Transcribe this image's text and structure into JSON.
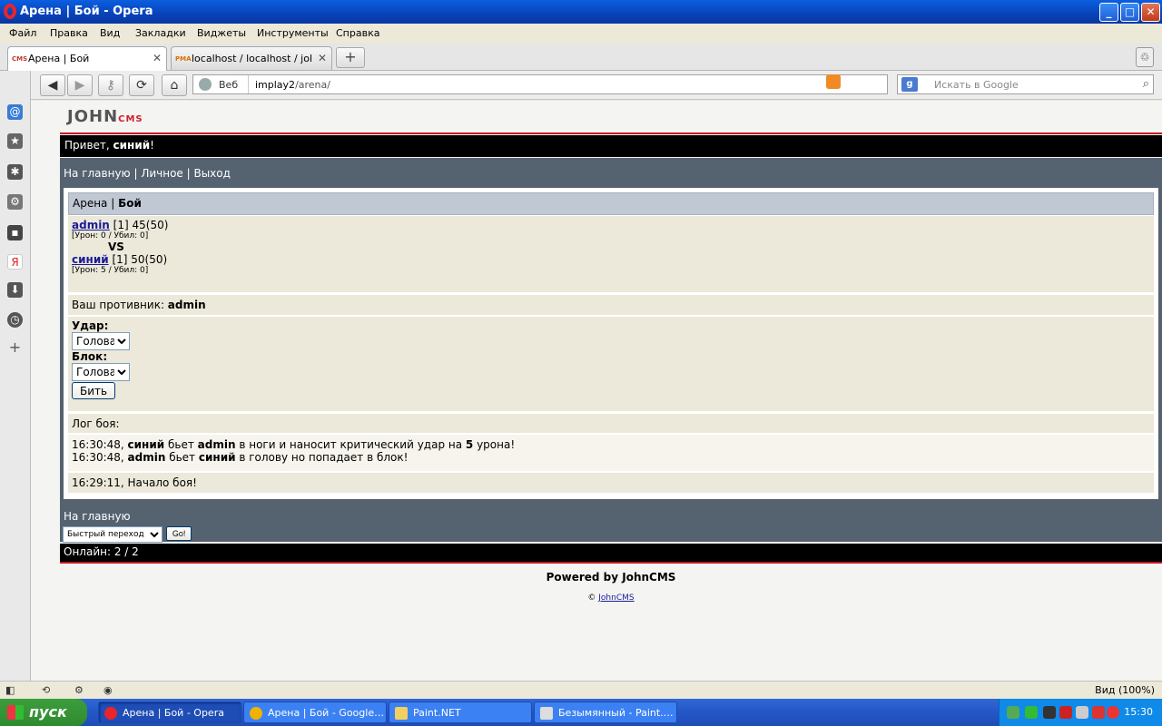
{
  "window": {
    "title": "Арена | Бой - Opera",
    "min_label": "_",
    "max_label": "□",
    "close_label": "✕"
  },
  "menu": [
    "Файл",
    "Правка",
    "Вид",
    "Закладки",
    "Виджеты",
    "Инструменты",
    "Справка"
  ],
  "tabs": [
    {
      "label": "Арена | Бой",
      "close": "✕"
    },
    {
      "label": "localhost / localhost / joh…",
      "close": "✕"
    }
  ],
  "addressbar": {
    "web_label": "Веб",
    "url_host": "implay2",
    "url_path": "/arena/",
    "search_placeholder": "Искать в Google"
  },
  "page": {
    "logo_main": "JOHN",
    "logo_sub": "CMS",
    "greeting_prefix": "Привет, ",
    "greeting_user": "синий",
    "greeting_suffix": "!",
    "nav": {
      "home": "На главную",
      "sep1": " | ",
      "personal": "Личное",
      "sep2": " | ",
      "logout": "Выход"
    },
    "header_prefix": "Арена | ",
    "header_bold": "Бой",
    "fighter1": {
      "name": "admin",
      "stats": " [1] 45(50)",
      "detail": "[Урон: 0 / Убил: 0]"
    },
    "vs": "VS",
    "fighter2": {
      "name": "синий",
      "stats": " [1] 50(50)",
      "detail": "[Урон: 5 / Убил: 0]"
    },
    "opponent_label": "Ваш противник: ",
    "opponent_name": "admin",
    "attack_label": "Удар:",
    "attack_value": "Голова",
    "block_label": "Блок:",
    "block_value": "Голова",
    "hit_button": "Бить",
    "log_label": "Лог боя:",
    "log": [
      {
        "time": "16:30:48, ",
        "a": "синий",
        "mid": " бьет ",
        "b": "admin",
        "rest": " в ноги и наносит критический удар на ",
        "num": "5",
        "end": " урона!"
      },
      {
        "time": "16:30:48, ",
        "a": "admin",
        "mid": " бьет ",
        "b": "синий",
        "rest": " в голову но попадает в блок!",
        "num": "",
        "end": ""
      }
    ],
    "log_start": "16:29:11, Начало боя!",
    "bottom_home": "На главную",
    "quick_jump": "Быстрый переход",
    "go_button": "Go!",
    "online": "Онлайн: 2 / 2",
    "powered": "Powered by JohnCMS",
    "copyright_sign": "© ",
    "copyright_link": "JohnCMS"
  },
  "status": {
    "zoom": "Вид (100%)"
  },
  "taskbar": {
    "start": "пуск",
    "tasks": [
      {
        "label": "Арена | Бой - Opera",
        "color": "#E8252A"
      },
      {
        "label": "Арена | Бой - Google…",
        "color": "#F2B200"
      },
      {
        "label": "Paint.NET",
        "color": "#F2D060"
      },
      {
        "label": "Безымянный - Paint.…",
        "color": "#DDDDDD"
      }
    ],
    "clock": "15:30"
  }
}
